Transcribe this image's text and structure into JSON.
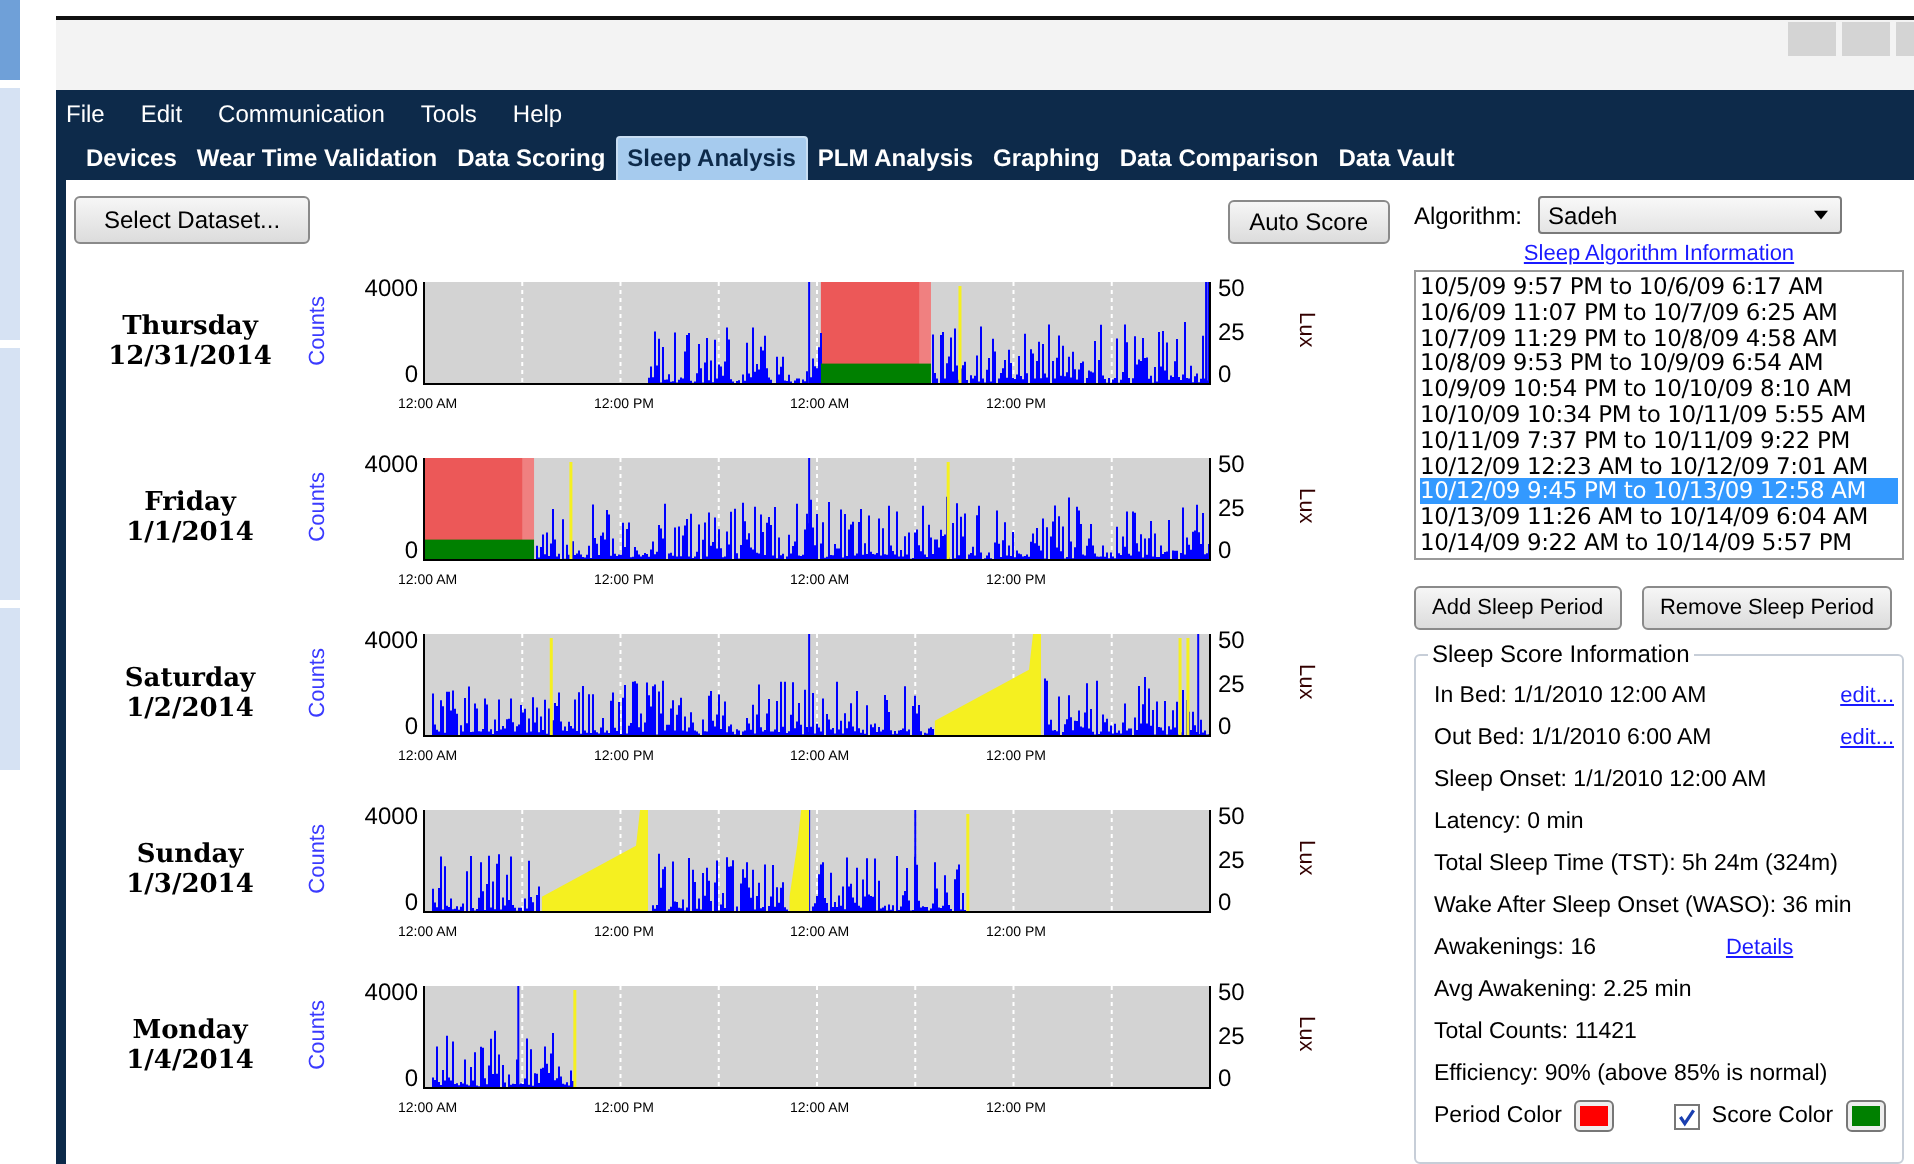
{
  "menu": [
    "File",
    "Edit",
    "Communication",
    "Tools",
    "Help"
  ],
  "tabs": [
    {
      "label": "Devices",
      "selected": false
    },
    {
      "label": "Wear Time Validation",
      "selected": false
    },
    {
      "label": "Data Scoring",
      "selected": false
    },
    {
      "label": "Sleep Analysis",
      "selected": true
    },
    {
      "label": "PLM Analysis",
      "selected": false
    },
    {
      "label": "Graphing",
      "selected": false
    },
    {
      "label": "Data Comparison",
      "selected": false
    },
    {
      "label": "Data Vault",
      "selected": false
    }
  ],
  "select_dataset_button": "Select Dataset...",
  "auto_score_button": "Auto Score",
  "days": [
    {
      "weekday": "Thursday",
      "date": "12/31/2014",
      "left_axis": "Counts",
      "right_axis": "Lux",
      "left_ticks": [
        "4000",
        "0"
      ],
      "right_ticks": [
        "50",
        "25",
        "0"
      ],
      "x_ticks": [
        "12:00 AM",
        "12:00 PM",
        "12:00 AM",
        "12:00 PM"
      ]
    },
    {
      "weekday": "Friday",
      "date": "1/1/2014",
      "left_axis": "Counts",
      "right_axis": "Lux",
      "left_ticks": [
        "4000",
        "0"
      ],
      "right_ticks": [
        "50",
        "25",
        "0"
      ],
      "x_ticks": [
        "12:00 AM",
        "12:00 PM",
        "12:00 AM",
        "12:00 PM"
      ]
    },
    {
      "weekday": "Saturday",
      "date": "1/2/2014",
      "left_axis": "Counts",
      "right_axis": "Lux",
      "left_ticks": [
        "4000",
        "0"
      ],
      "right_ticks": [
        "50",
        "25",
        "0"
      ],
      "x_ticks": [
        "12:00 AM",
        "12:00 PM",
        "12:00 AM",
        "12:00 PM"
      ]
    },
    {
      "weekday": "Sunday",
      "date": "1/3/2014",
      "left_axis": "Counts",
      "right_axis": "Lux",
      "left_ticks": [
        "4000",
        "0"
      ],
      "right_ticks": [
        "50",
        "25",
        "0"
      ],
      "x_ticks": [
        "12:00 AM",
        "12:00 PM",
        "12:00 AM",
        "12:00 PM"
      ]
    },
    {
      "weekday": "Monday",
      "date": "1/4/2014",
      "left_axis": "Counts",
      "right_axis": "Lux",
      "left_ticks": [
        "4000",
        "0"
      ],
      "right_ticks": [
        "50",
        "25",
        "0"
      ],
      "x_ticks": [
        "12:00 AM",
        "12:00 PM",
        "12:00 AM",
        "12:00 PM"
      ]
    }
  ],
  "algorithm": {
    "label": "Algorithm:",
    "value": "Sadeh"
  },
  "info_link": "Sleep Algorithm Information",
  "sleep_periods": [
    {
      "text": "10/5/09 9:57 PM to 10/6/09 6:17 AM",
      "selected": false
    },
    {
      "text": "10/6/09 11:07 PM to 10/7/09 6:25 AM",
      "selected": false
    },
    {
      "text": "10/7/09 11:29 PM to 10/8/09 4:58 AM",
      "selected": false
    },
    {
      "text": "10/8/09 9:53 PM to 10/9/09 6:54 AM",
      "selected": false
    },
    {
      "text": "10/9/09 10:54 PM to 10/10/09 8:10 AM",
      "selected": false
    },
    {
      "text": "10/10/09 10:34 PM to 10/11/09 5:55 AM",
      "selected": false
    },
    {
      "text": "10/11/09 7:37 PM to 10/11/09 9:22 PM",
      "selected": false
    },
    {
      "text": "10/12/09 12:23 AM to 10/12/09 7:01 AM",
      "selected": false
    },
    {
      "text": "10/12/09 9:45 PM to 10/13/09 12:58 AM",
      "selected": true
    },
    {
      "text": "10/13/09 11:26 AM to 10/14/09 6:04 AM",
      "selected": false
    },
    {
      "text": "10/14/09 9:22 AM to 10/14/09 5:57 PM",
      "selected": false
    }
  ],
  "period_buttons": [
    "Add Sleep Period",
    "Remove Sleep Period"
  ],
  "sleep_score": {
    "title": "Sleep Score Information",
    "rows": [
      {
        "text": "In Bed: 1/1/2010 12:00 AM",
        "link": "edit..."
      },
      {
        "text": "Out Bed: 1/1/2010 6:00 AM",
        "link": "edit..."
      },
      {
        "text": "Sleep Onset: 1/1/2010 12:00 AM"
      },
      {
        "text": "Latency: 0 min"
      },
      {
        "text": "Total Sleep Time (TST): 5h 24m (324m)"
      },
      {
        "text": "Wake After Sleep Onset (WASO): 36 min"
      },
      {
        "text": "Awakenings: 16",
        "link": "Details"
      },
      {
        "text": "Avg Awakening: 2.25 min"
      },
      {
        "text": "Total Counts: 11421"
      },
      {
        "text": "Efficiency: 90% (above 85% is normal)"
      }
    ],
    "period_color": {
      "label": "Period Color",
      "color": "#ff0000"
    },
    "score_color": {
      "label": "Score Color",
      "checked": true,
      "color": "#008000"
    }
  }
}
